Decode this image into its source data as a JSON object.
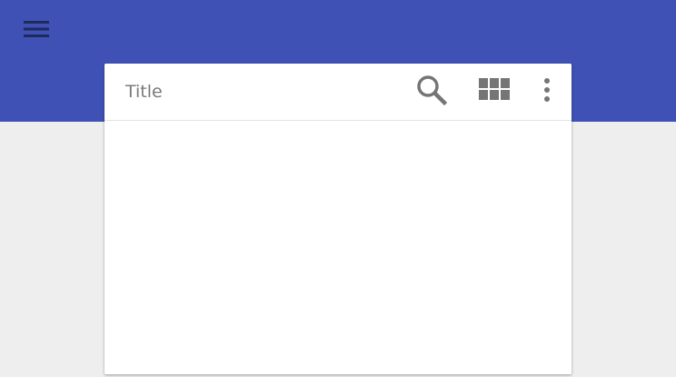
{
  "app_bar": {
    "color": "#3F51B5",
    "menu_icon": "hamburger-menu-icon"
  },
  "card": {
    "title": "Title",
    "actions": [
      {
        "name": "search",
        "icon": "search-icon"
      },
      {
        "name": "grid-view",
        "icon": "grid-view-icon"
      },
      {
        "name": "more-options",
        "icon": "more-vert-icon"
      }
    ]
  },
  "colors": {
    "background": "#EEEEEE",
    "card": "#FFFFFF",
    "icon": "#757575",
    "title_text": "#7A7A7A"
  }
}
